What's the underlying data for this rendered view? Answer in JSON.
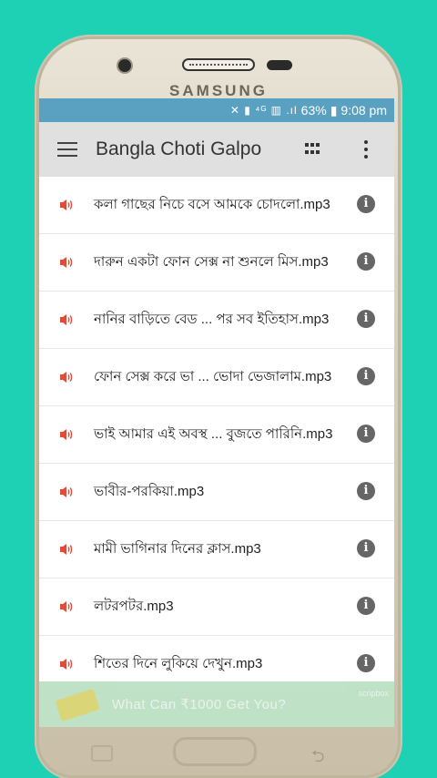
{
  "device": {
    "brand": "SAMSUNG"
  },
  "status_bar": {
    "icons": "✕ ▮ ⁴ᴳ ▥ .ıl",
    "battery": "63%",
    "time": "9:08 pm"
  },
  "toolbar": {
    "title": "Bangla Choti Galpo"
  },
  "colors": {
    "background": "#1fd1b4",
    "status_bar": "#5aa0c0",
    "toolbar": "#e0e0e0",
    "speaker_icon": "#e04b3a",
    "info_icon": "#666666"
  },
  "items": [
    {
      "label": "কলা গাছের নিচে বসে আমকে চোদলো.mp3"
    },
    {
      "label": "দারুন একটা ফোন সেক্স না শুনলে মিস.mp3"
    },
    {
      "label": "নানির বাড়িতে বেড ... পর সব ইতিহাস.mp3"
    },
    {
      "label": "ফোন সেক্স করে ভা ... ভোদা ভেজালাম.mp3"
    },
    {
      "label": "ভাই আমার এই অবস্থ ... বুজতে পারিনি.mp3"
    },
    {
      "label": "ভাবীর-পরকিয়া.mp3"
    },
    {
      "label": "মামী ভাগিনার দিনের ক্লাস.mp3"
    },
    {
      "label": "লটরপটর.mp3"
    },
    {
      "label": "শিতের দিনে লুকিয়ে দেখুন.mp3"
    }
  ],
  "ad": {
    "text": "What Can ₹1000 Get You?",
    "brand": "scripbox"
  }
}
